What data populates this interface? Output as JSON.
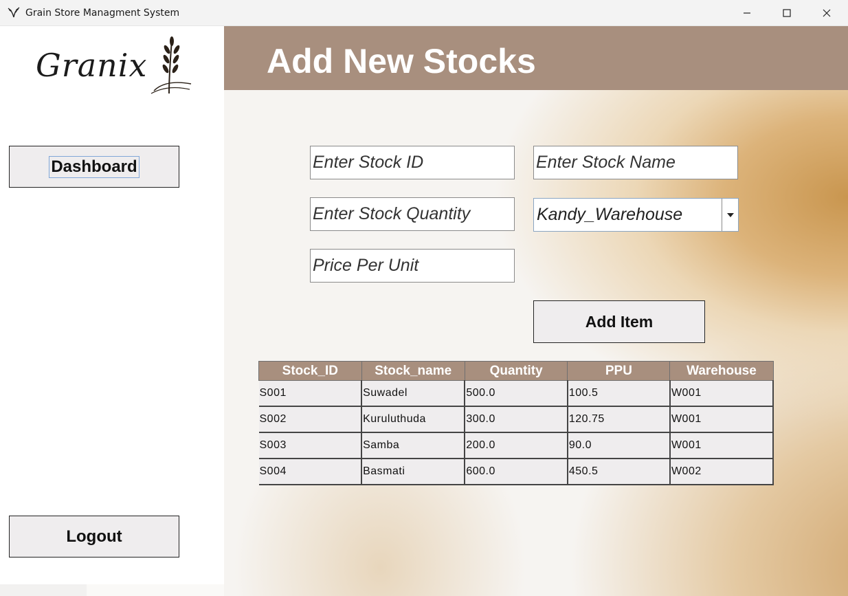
{
  "window": {
    "title": "Grain Store Managment System"
  },
  "sidebar": {
    "logo_text": "Granix",
    "dashboard_label": "Dashboard",
    "logout_label": "Logout"
  },
  "header": {
    "title": "Add New Stocks"
  },
  "form": {
    "stock_id_placeholder": "Enter Stock ID",
    "stock_name_placeholder": "Enter Stock Name",
    "stock_quantity_placeholder": "Enter Stock Quantity",
    "price_placeholder": "Price Per Unit",
    "warehouse_selected": "Kandy_Warehouse",
    "add_button_label": "Add Item"
  },
  "table": {
    "columns": [
      "Stock_ID",
      "Stock_name",
      "Quantity",
      "PPU",
      "Warehouse"
    ],
    "rows": [
      [
        "S001",
        "Suwadel",
        "500.0",
        "100.5",
        "W001"
      ],
      [
        "S002",
        "Kuruluthuda",
        "300.0",
        "120.75",
        "W001"
      ],
      [
        "S003",
        "Samba",
        "200.0",
        "90.0",
        "W001"
      ],
      [
        "S004",
        "Basmati",
        "600.0",
        "450.5",
        "W002"
      ]
    ]
  },
  "colors": {
    "accent": "#a88f7e",
    "button_bg": "#efedee"
  },
  "icons": {
    "app": "wheat-icon",
    "minimize": "minimize-icon",
    "maximize": "maximize-icon",
    "close": "close-icon",
    "dropdown": "triangle-down-icon",
    "logo": "wheat-logo-icon"
  }
}
